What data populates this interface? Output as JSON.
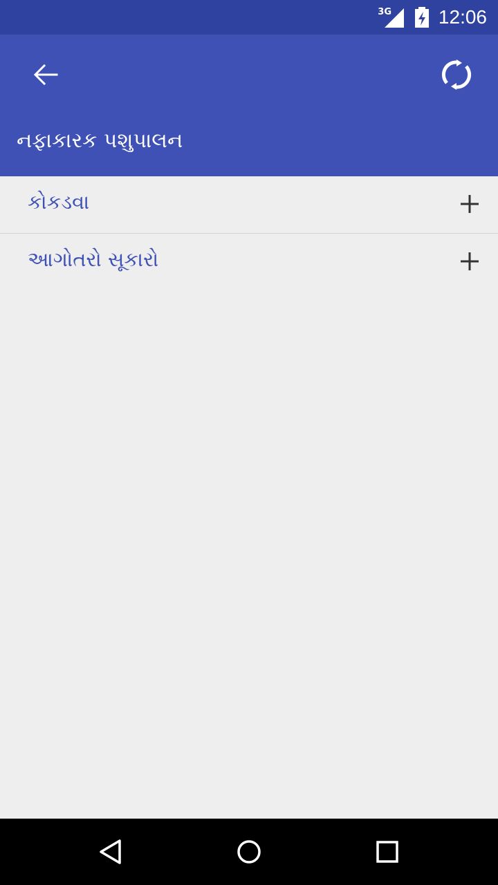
{
  "status_bar": {
    "network": "3G",
    "time": "12:06",
    "icons": [
      "signal-icon",
      "battery-charging-icon"
    ]
  },
  "app_bar": {
    "title": "નફાકારક પશુપાલન",
    "icons": [
      "back-arrow-icon",
      "refresh-icon"
    ]
  },
  "list": {
    "items": [
      {
        "label": "કોકડવા",
        "icon": "plus-icon"
      },
      {
        "label": "આગોતરો સૂકારો",
        "icon": "plus-icon"
      }
    ]
  },
  "nav_bar": {
    "icons": [
      "nav-back-icon",
      "nav-home-icon",
      "nav-recents-icon"
    ]
  },
  "colors": {
    "primary": "#3f51b5",
    "primary_dark": "#2f42a0",
    "background": "#eeeeee",
    "label": "#3f51b5"
  }
}
